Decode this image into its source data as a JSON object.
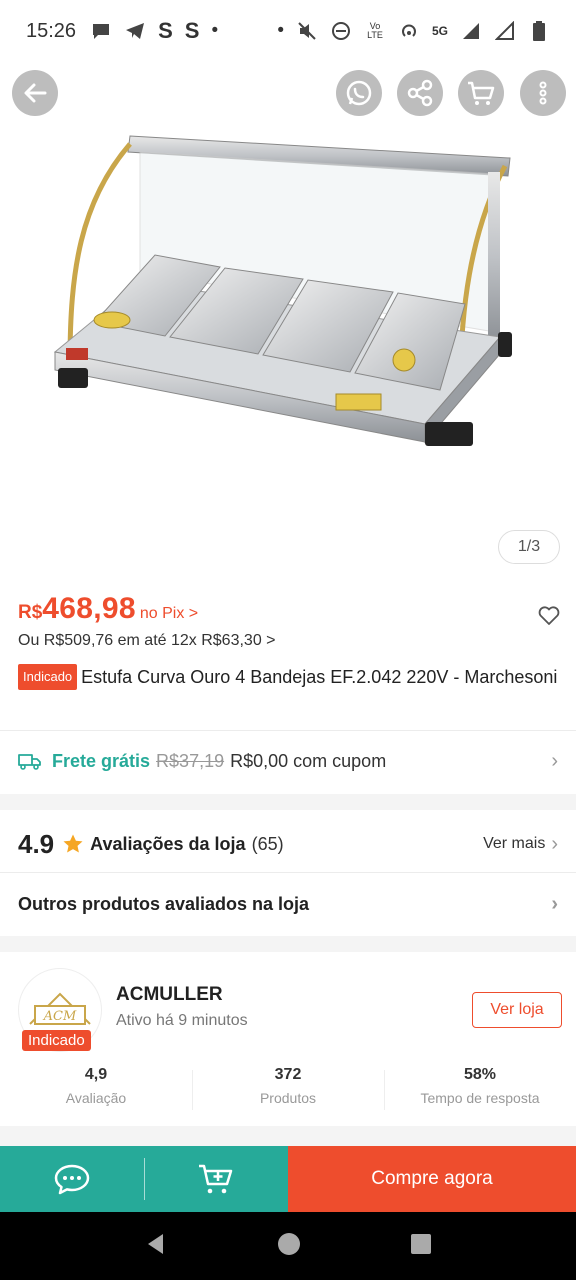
{
  "status_bar": {
    "time": "15:26",
    "s1": "S",
    "s2": "S",
    "dot": "•",
    "dot2": "•",
    "network": "5G",
    "volte": "Vo LTE"
  },
  "hero": {
    "page_counter": "1/3"
  },
  "price": {
    "currency": "R$",
    "value": "468,98",
    "pix_label": "no Pix >",
    "installments": "Ou R$509,76 em até 12x R$63,30 >"
  },
  "product": {
    "badge": "Indicado",
    "title": "Estufa Curva Ouro 4 Bandejas EF.2.042 220V - Marchesoni"
  },
  "shipping": {
    "title": "Frete grátis",
    "old_price": "R$37,19",
    "new_price": "R$0,00 com cupom"
  },
  "ratings": {
    "score": "4.9",
    "label": "Avaliações da loja",
    "count": "(65)",
    "see_more": "Ver mais"
  },
  "other_products": {
    "label": "Outros produtos avaliados na loja"
  },
  "store": {
    "logo_text": "ACM",
    "badge": "Indicado",
    "name": "ACMULLER",
    "active": "Ativo há 9 minutos",
    "button": "Ver loja",
    "stats": [
      {
        "value": "4,9",
        "label": "Avaliação"
      },
      {
        "value": "372",
        "label": "Produtos"
      },
      {
        "value": "58%",
        "label": "Tempo de resposta"
      }
    ]
  },
  "bottom_bar": {
    "buy_label": "Compre agora"
  },
  "colors": {
    "brand": "#ee4d2d",
    "teal": "#26aa99"
  },
  "icons": [
    "back-icon",
    "whatsapp-icon",
    "share-icon",
    "cart-icon",
    "more-icon",
    "heart-icon",
    "truck-icon",
    "star-icon",
    "chat-icon",
    "add-to-cart-icon"
  ]
}
